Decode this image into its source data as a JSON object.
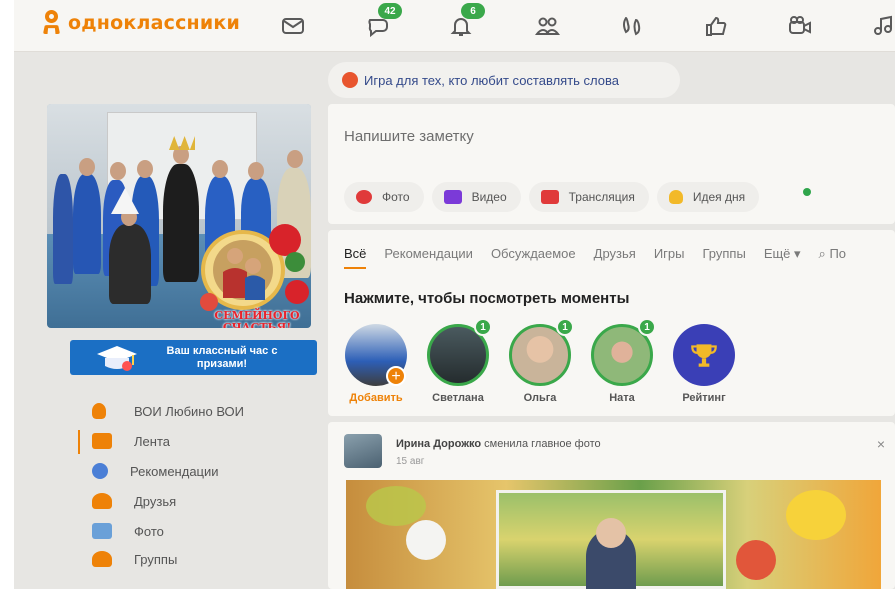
{
  "brand": {
    "name": "одноклассники",
    "color": "#ee8208"
  },
  "topbar": {
    "icons": [
      {
        "name": "mail-icon"
      },
      {
        "name": "chat-icon",
        "badge": "42"
      },
      {
        "name": "bell-icon",
        "badge": "6"
      },
      {
        "name": "friends-icon"
      },
      {
        "name": "guests-icon"
      },
      {
        "name": "likes-icon"
      },
      {
        "name": "video-camera-icon"
      },
      {
        "name": "music-icon"
      }
    ]
  },
  "game_promo": {
    "text": "Игра для тех, кто любит составлять слова"
  },
  "profile": {
    "photo_caption": "СЕМЕЙНОГО СЧАСТЬЯ!",
    "promo_banner": "Ваш классный час с призами!"
  },
  "sidebar": {
    "items": [
      {
        "label": "ВОИ Любино ВОИ",
        "icon": "user-icon",
        "color": "#ee8208"
      },
      {
        "label": "Лента",
        "icon": "feed-icon",
        "color": "#ee8208",
        "active": true
      },
      {
        "label": "Рекомендации",
        "icon": "compass-icon",
        "color": "#4b7fd6"
      },
      {
        "label": "Друзья",
        "icon": "friends-icon",
        "color": "#ee8208"
      },
      {
        "label": "Фото",
        "icon": "photo-icon",
        "color": "#6aa0d8"
      },
      {
        "label": "Группы",
        "icon": "groups-icon",
        "color": "#ee8208"
      }
    ]
  },
  "composer": {
    "placeholder": "Напишите заметку",
    "buttons": [
      {
        "label": "Фото",
        "icon": "photo-icon",
        "color": "#e03a3a"
      },
      {
        "label": "Видео",
        "icon": "video-icon",
        "color": "#7b3ad8"
      },
      {
        "label": "Трансляция",
        "icon": "broadcast-icon",
        "color": "#e03a3a"
      },
      {
        "label": "Идея дня",
        "icon": "lightbulb-icon",
        "color": "#f2b928"
      }
    ]
  },
  "feed_tabs": [
    "Всё",
    "Рекомендации",
    "Обсуждаемое",
    "Друзья",
    "Игры",
    "Группы",
    "Ещё ▾",
    "По"
  ],
  "moments": {
    "title": "Нажмите, чтобы посмотреть моменты",
    "items": [
      {
        "label": "Добавить",
        "badge": null
      },
      {
        "label": "Светлана",
        "badge": "1"
      },
      {
        "label": "Ольга",
        "badge": "1"
      },
      {
        "label": "Ната",
        "badge": "1"
      },
      {
        "label": "Рейтинг",
        "badge": null
      }
    ]
  },
  "news": {
    "author": "Ирина Дорожко",
    "action": "сменила главное фото",
    "date": "15 авг",
    "close": "×"
  }
}
